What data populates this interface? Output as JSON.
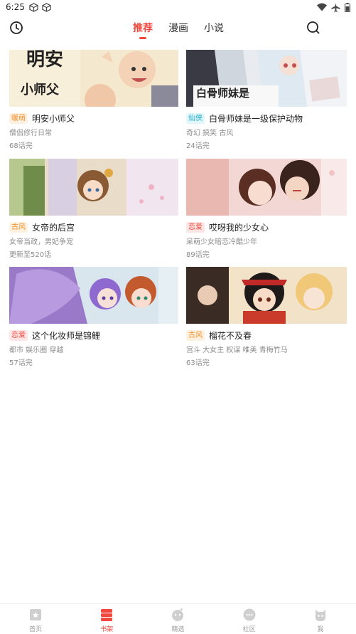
{
  "status_bar": {
    "time": "6:25",
    "left_icons": [
      "cube-icon",
      "cube-icon"
    ],
    "right_icons": [
      "wifi-icon",
      "airplane-icon",
      "battery-icon"
    ]
  },
  "header": {
    "left_icon": "history-clock-icon",
    "right_icon": "search-icon",
    "tabs": [
      {
        "label": "推荐",
        "active": true
      },
      {
        "label": "漫画",
        "active": false
      },
      {
        "label": "小说",
        "active": false
      }
    ]
  },
  "comics": [
    {
      "cover_text": "小师父",
      "tag": "暖萌",
      "tag_color": "#f0902a",
      "tag_bg": "#fff1e0",
      "title": "明安小师父",
      "subtitle": "僧侣修行日常",
      "episodes": "68话完"
    },
    {
      "cover_text": "白骨师妹是",
      "tag": "仙侠",
      "tag_color": "#1fa9c4",
      "tag_bg": "#e0f6fa",
      "title": "白骨师妹是一级保护动物",
      "subtitle": "奇幻 搞笑 古风",
      "episodes": "24话完"
    },
    {
      "cover_text": "",
      "tag": "古风",
      "tag_color": "#f0902a",
      "tag_bg": "#fff1e0",
      "title": "女帝的后宫",
      "subtitle": "女帝当政，男妃争宠",
      "episodes": "更新至520话"
    },
    {
      "cover_text": "",
      "tag": "恋爱",
      "tag_color": "#f0483e",
      "tag_bg": "#ffe6e4",
      "title": "哎呀我的少女心",
      "subtitle": "呆萌少女暗恋冷酷少年",
      "episodes": "89话完"
    },
    {
      "cover_text": "",
      "tag": "恋爱",
      "tag_color": "#f0483e",
      "tag_bg": "#ffe6e4",
      "title": "这个化妆师是锦鲤",
      "subtitle": "都市 娱乐圈 穿越",
      "episodes": "57话完"
    },
    {
      "cover_text": "",
      "tag": "古风",
      "tag_color": "#f0902a",
      "tag_bg": "#fff1e0",
      "title": "榴花不及春",
      "subtitle": "宫斗 大女主 权谋 唯美 青梅竹马",
      "episodes": "63话完"
    }
  ],
  "bottom_nav": [
    {
      "label": "首页",
      "icon": "home-star-icon",
      "active": false
    },
    {
      "label": "书架",
      "icon": "bookshelf-icon",
      "active": true
    },
    {
      "label": "精选",
      "icon": "featured-face-icon",
      "active": false
    },
    {
      "label": "社区",
      "icon": "community-chat-icon",
      "active": false
    },
    {
      "label": "我",
      "icon": "profile-cat-icon",
      "active": false
    }
  ],
  "colors": {
    "accent": "#f0483e",
    "muted_text": "#8c8c8c",
    "nav_icon": "#cfcfcf"
  }
}
